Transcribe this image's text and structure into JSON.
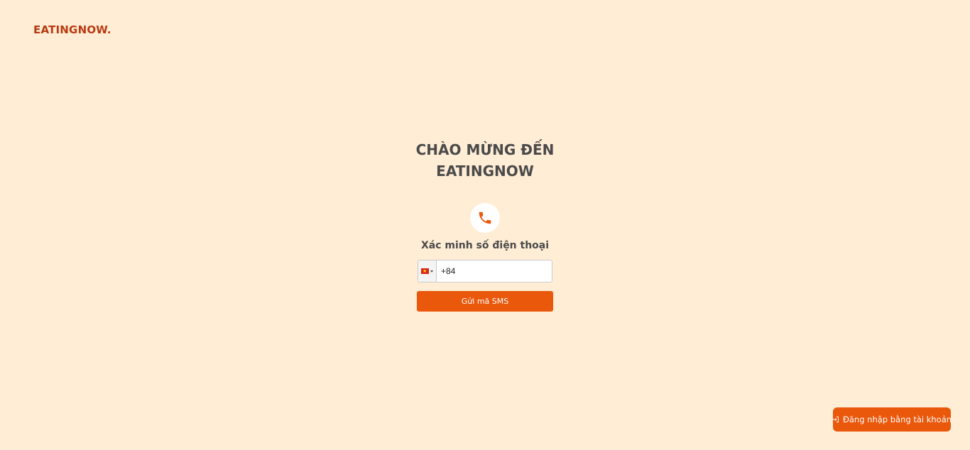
{
  "header": {
    "logo": "EATINGNOW."
  },
  "main": {
    "title_line1": "CHÀO MỪNG ĐẾN",
    "title_line2": "EATINGNOW",
    "phone_icon": "phone-icon",
    "subtitle": "Xác minh số điện thoại",
    "phone_input": {
      "country_flag": "vietnam-flag",
      "value": "+84"
    },
    "send_sms_label": "Gửi mã SMS"
  },
  "footer": {
    "account_login_label": "Đăng nhập bằng tài khoản",
    "account_login_icon": "login-icon"
  },
  "colors": {
    "background": "#FFEDD5",
    "accent": "#EA580C",
    "logo": "#B83A12",
    "text": "#4A4A4A"
  }
}
